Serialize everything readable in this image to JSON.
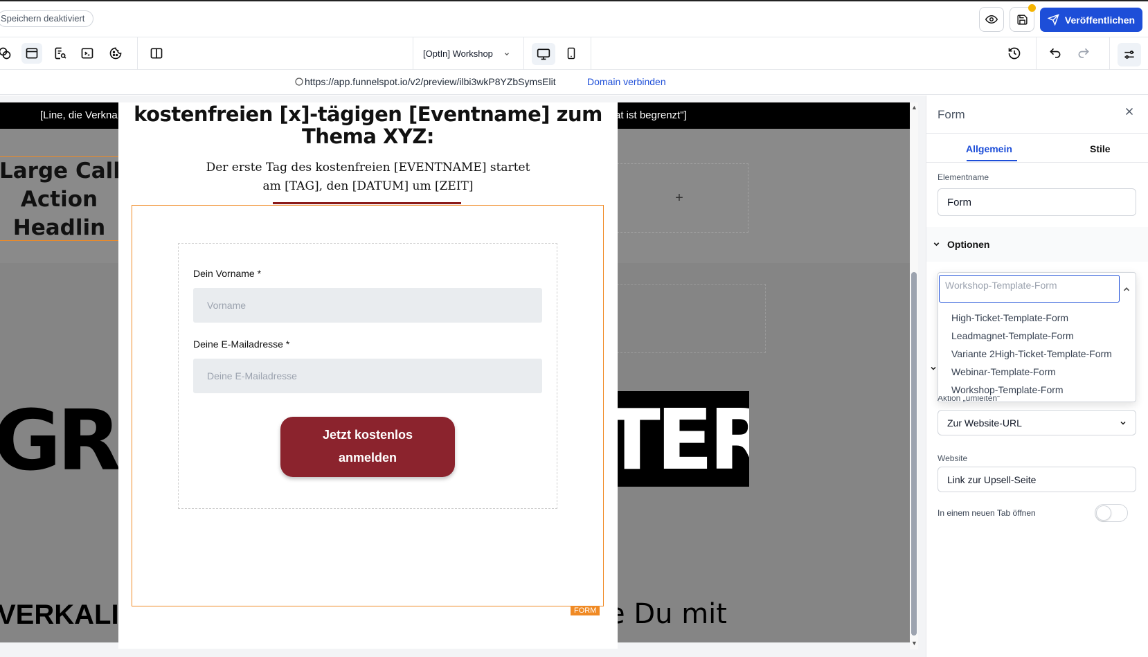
{
  "topbar": {
    "autosave_label": "Speichern deaktiviert",
    "publish_label": "Veröffentlichen"
  },
  "toolbar": {
    "page_select": "[OptIn] Workshop"
  },
  "urlbar": {
    "url": "https://app.funnelspot.io/v2/preview/ilbi3wkP8YZbSymsElit",
    "domain_link": "Domain verbinden"
  },
  "canvas": {
    "topbar_left": "[Line, die Verkna",
    "topbar_right": "at ist begrenzt\"]",
    "cta_headline_lines": [
      "Large Call",
      "Action",
      "Headlin"
    ],
    "big_left": "GRO",
    "big_right": "TER",
    "bottom_left": "VERKALI",
    "bottom_right": "e Du mit",
    "plus": "+"
  },
  "modal": {
    "title_line1": "kostenfreien [x]-tägigen [Eventname] zum",
    "title_line2": "Thema XYZ:",
    "subtitle_line1": "Der erste Tag des kostenfreien [EVENTNAME] startet",
    "subtitle_line2": "am [TAG], den [DATUM] um [ZEIT]",
    "form": {
      "firstname_label": "Dein Vorname *",
      "firstname_placeholder": "Vorname",
      "email_label": "Deine E-Mailadresse *",
      "email_placeholder": "Deine E-Mailadresse",
      "cta_line1": "Jetzt kostenlos",
      "cta_line2": "anmelden",
      "tag": "FORM"
    }
  },
  "panel": {
    "title": "Form",
    "tabs": [
      "Allgemein",
      "Stile"
    ],
    "active_tab": "Allgemein",
    "element_name_label": "Elementname",
    "element_name_value": "Form",
    "options_header": "Optionen",
    "form_select_placeholder": "Workshop-Template-Form",
    "form_options": [
      "High-Ticket-Template-Form",
      "Leadmagnet-Template-Form",
      "Variante 2High-Ticket-Template-Form",
      "Webinar-Template-Form",
      "Workshop-Template-Form"
    ],
    "action_label": "Aktion „umleiten“",
    "action_value": "Zur Website-URL",
    "website_label": "Website",
    "website_value": "Link zur Upsell-Seite",
    "newtab_label": "In einem neuen Tab öffnen",
    "newtab_enabled": false
  },
  "colors": {
    "accent": "#1d4ed8",
    "cta": "#8b232d",
    "form_border": "#f08a24",
    "notification": "#f5b400"
  }
}
